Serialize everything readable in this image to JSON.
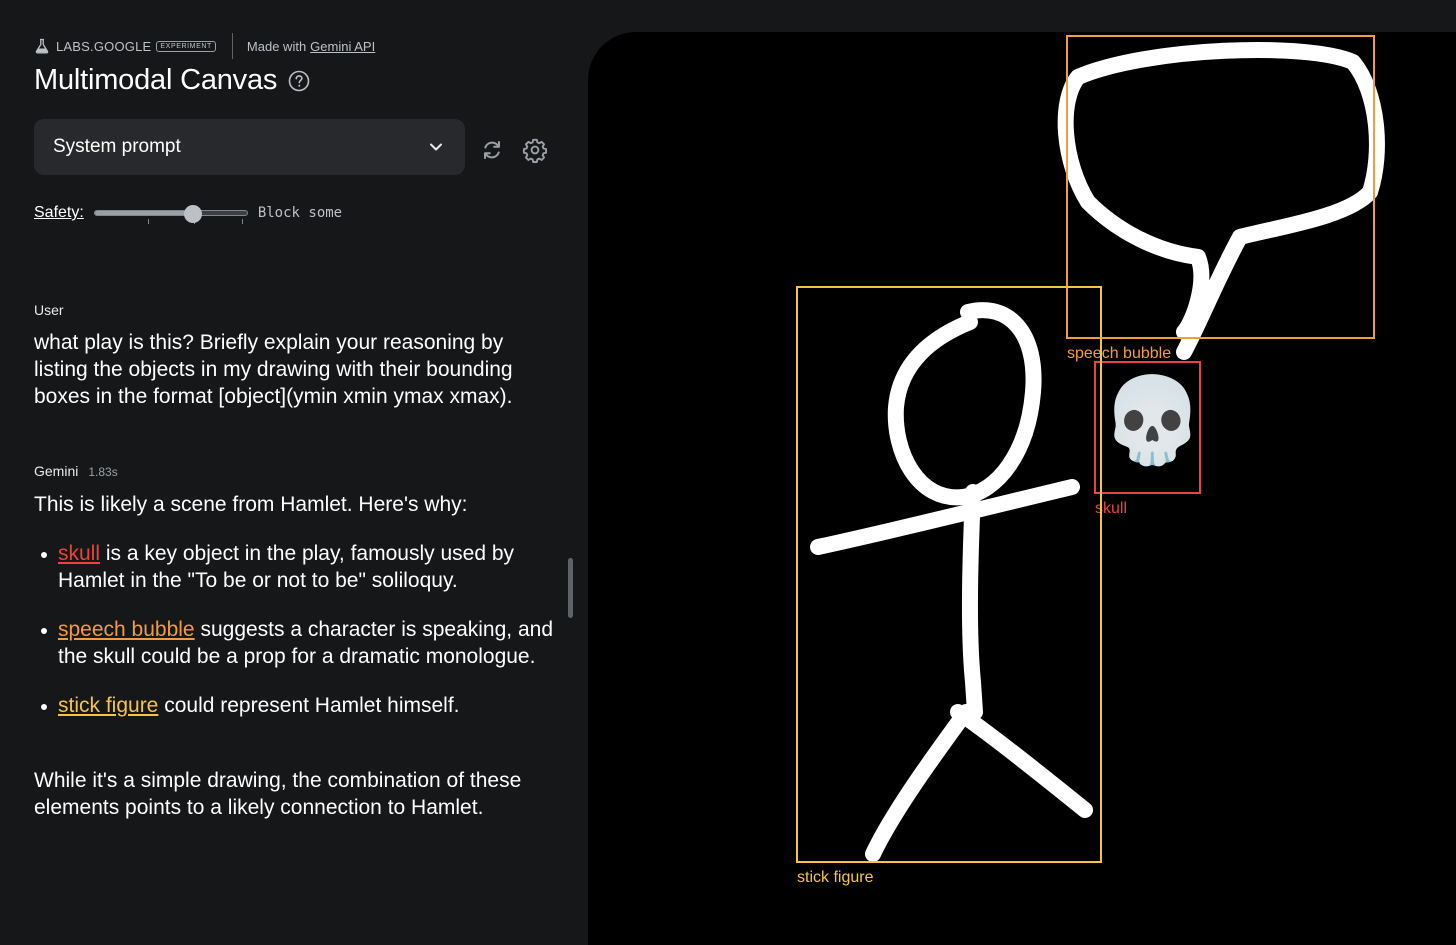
{
  "header": {
    "brand": "LABS.GOOGLE",
    "badge": "EXPERIMENT",
    "made_with_prefix": "Made with",
    "made_with_link": "Gemini API",
    "title": "Multimodal Canvas",
    "help_icon": "help-circle-icon"
  },
  "controls": {
    "dropdown_label": "System prompt",
    "dropdown_icon": "chevron-down-icon",
    "refresh_icon": "refresh-icon",
    "settings_icon": "gear-icon",
    "safety_label": "Safety:",
    "safety_value": "Block some",
    "safety_level": 0.66
  },
  "conversation": {
    "user_label": "User",
    "user_message": "what play is this? Briefly explain your reasoning by listing the objects in my drawing with their bounding boxes in the format [object](ymin xmin ymax xmax).",
    "model_label": "Gemini",
    "model_time": "1.83s",
    "intro": "This is likely a scene from Hamlet. Here's why:",
    "items": [
      {
        "link": "skull",
        "text": " is a key object in the play, famously used by Hamlet in the \"To be or not to be\" soliloquy."
      },
      {
        "link": "speech bubble",
        "text": " suggests a character is speaking, and the skull could be a prop for a dramatic monologue."
      },
      {
        "link": "stick figure",
        "text": " could represent Hamlet himself."
      }
    ],
    "outro": "While it's a simple drawing, the combination of these elements points to a likely connection to Hamlet."
  },
  "canvas": {
    "boxes": [
      {
        "label": "speech bubble",
        "color": "#f29b42"
      },
      {
        "label": "skull",
        "color": "#e8453c"
      },
      {
        "label": "stick figure",
        "color": "#f5c542"
      }
    ],
    "skull_emoji": "💀"
  }
}
